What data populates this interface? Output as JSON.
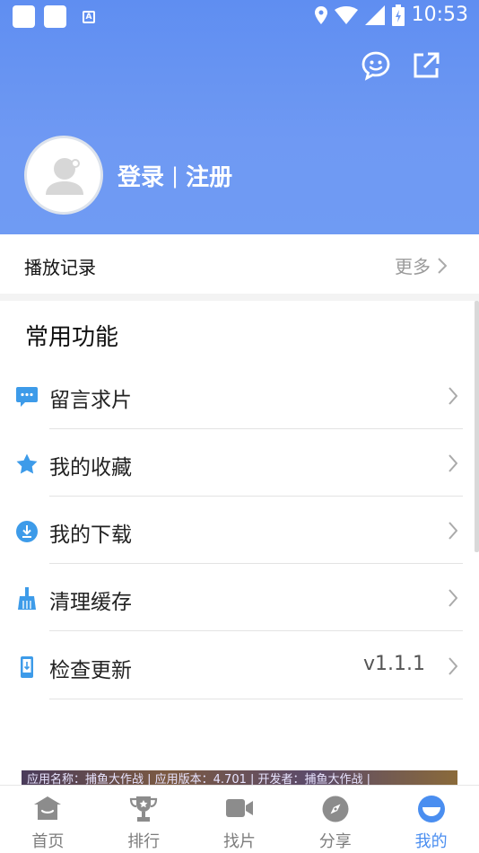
{
  "status_bar": {
    "time": "10:53"
  },
  "header": {
    "login_label": "登录",
    "separator": "|",
    "register_label": "注册"
  },
  "history": {
    "title": "播放记录",
    "more_label": "更多"
  },
  "section": {
    "title": "常用功能"
  },
  "menu": [
    {
      "label": "留言求片",
      "icon": "message-icon",
      "value": ""
    },
    {
      "label": "我的收藏",
      "icon": "star-icon",
      "value": ""
    },
    {
      "label": "我的下载",
      "icon": "download-icon",
      "value": ""
    },
    {
      "label": "清理缓存",
      "icon": "broom-icon",
      "value": ""
    },
    {
      "label": "检查更新",
      "icon": "update-icon",
      "value": "v1.1.1"
    }
  ],
  "ad": {
    "text": "应用名称：捕鱼大作战 | 应用版本：4.701 | 开发者：捕鱼大作战 |"
  },
  "tabs": [
    {
      "label": "首页",
      "icon": "home-icon",
      "active": false
    },
    {
      "label": "排行",
      "icon": "trophy-icon",
      "active": false
    },
    {
      "label": "找片",
      "icon": "video-camera-icon",
      "active": false
    },
    {
      "label": "分享",
      "icon": "compass-icon",
      "active": false
    },
    {
      "label": "我的",
      "icon": "profile-icon",
      "active": true
    }
  ],
  "colors": {
    "header_blue": "#6f9bf3",
    "accent_blue": "#4a8ef0",
    "icon_blue": "#3d9be9",
    "tab_gray": "#8c8c8c"
  }
}
